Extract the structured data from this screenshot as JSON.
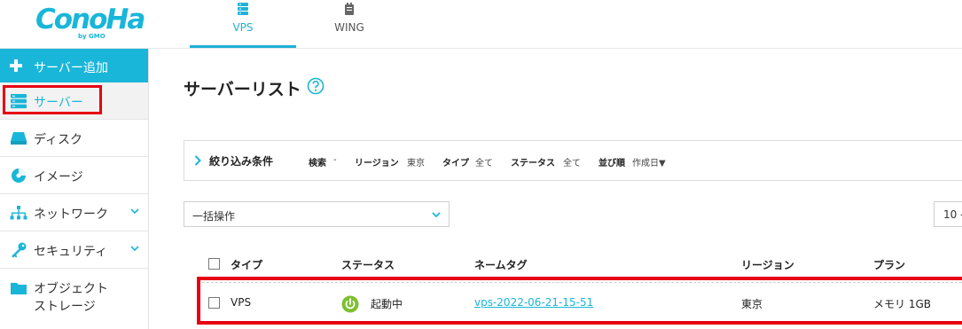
{
  "colors": {
    "accent": "#1ab6d9",
    "highlight": "#e60012",
    "status_running": "#7dbf2e"
  },
  "header": {
    "logo": {
      "name": "ConoHa",
      "sub": "by GMO"
    },
    "tabs": [
      {
        "label": "VPS",
        "icon": "server-stack-icon",
        "active": true
      },
      {
        "label": "WING",
        "icon": "wing-icon",
        "active": false
      }
    ]
  },
  "sidebar": {
    "add_server": {
      "label": "サーバー追加",
      "icon": "plus-icon"
    },
    "items": [
      {
        "label": "サーバー",
        "icon": "server-icon",
        "active": true
      },
      {
        "label": "ディスク",
        "icon": "disk-icon"
      },
      {
        "label": "イメージ",
        "icon": "image-icon"
      },
      {
        "label": "ネットワーク",
        "icon": "network-icon",
        "expandable": true
      },
      {
        "label": "セキュリティ",
        "icon": "key-icon",
        "expandable": true
      },
      {
        "label_line1": "オブジェクト",
        "label_line2": "ストレージ",
        "icon": "folder-icon"
      }
    ]
  },
  "main": {
    "title": "サーバーリスト",
    "filter": {
      "title": "絞り込み条件",
      "fields": [
        {
          "label": "検索",
          "value": "-"
        },
        {
          "label": "リージョン",
          "value": "東京"
        },
        {
          "label": "タイプ",
          "value": "全て"
        },
        {
          "label": "ステータス",
          "value": "全て"
        },
        {
          "label": "並び順",
          "value": "作成日▼"
        }
      ]
    },
    "bulk_action": {
      "value": "一括操作"
    },
    "per_page": {
      "value": "10 -"
    },
    "table": {
      "columns": [
        "タイプ",
        "ステータス",
        "ネームタグ",
        "リージョン",
        "プラン"
      ],
      "rows": [
        {
          "type": "VPS",
          "status": "起動中",
          "nametag": "vps-2022-06-21-15-51",
          "region": "東京",
          "plan": "メモリ 1GB"
        }
      ]
    }
  }
}
